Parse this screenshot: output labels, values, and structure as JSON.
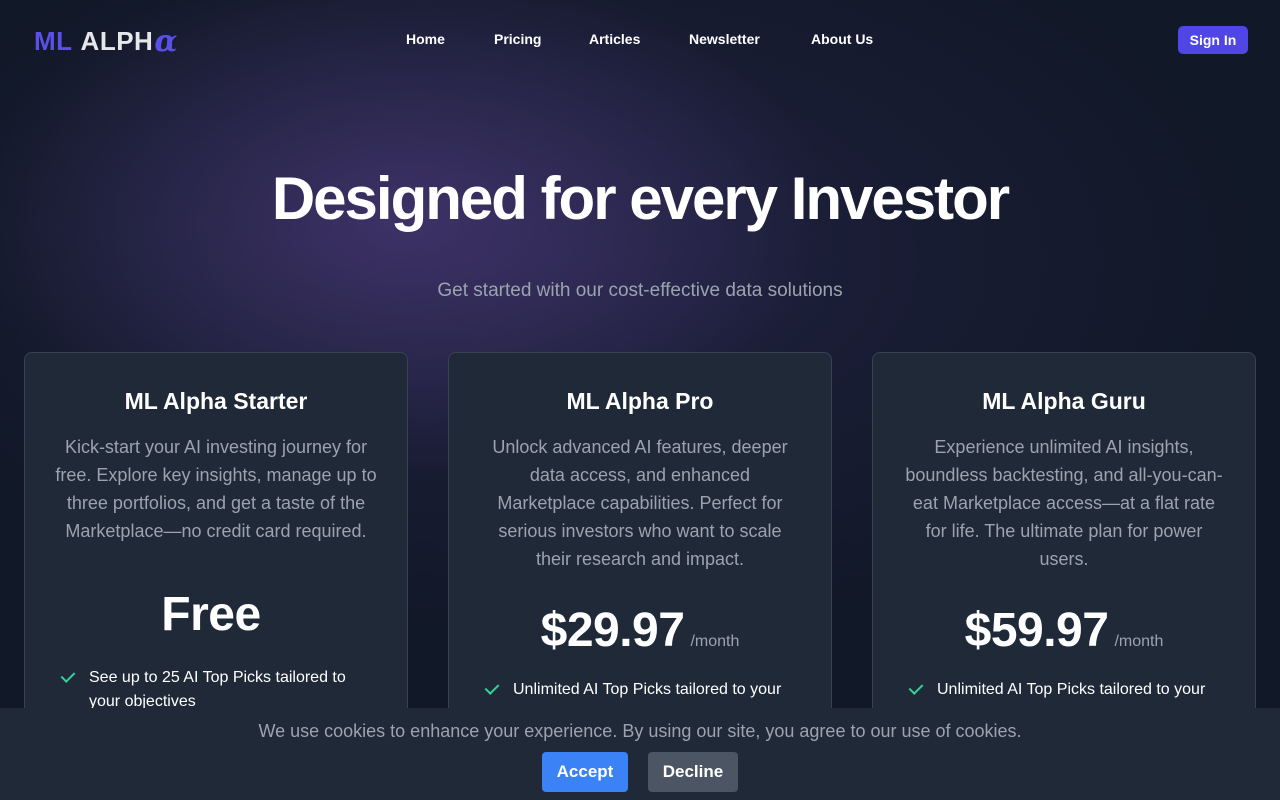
{
  "brand": {
    "logo_prefix": "ML",
    "logo_word": "ALPH",
    "logo_symbol": "α",
    "accent_color": "#5b50e6"
  },
  "nav": {
    "links": [
      "Home",
      "Pricing",
      "Articles",
      "Newsletter",
      "About Us"
    ],
    "signin_label": "Sign In"
  },
  "hero": {
    "title": "Designed for every Investor",
    "subtitle": "Get started with our cost-effective data solutions"
  },
  "plans": [
    {
      "name": "ML Alpha Starter",
      "description": "Kick-start your AI investing journey for free. Explore key insights, manage up to three portfolios, and get a taste of the Marketplace—no credit card required.",
      "price": "Free",
      "period": "",
      "feature": "See up to 25 AI Top Picks tailored to your objectives"
    },
    {
      "name": "ML Alpha Pro",
      "description": "Unlock advanced AI features, deeper data access, and enhanced Marketplace capabilities. Perfect for serious investors who want to scale their research and impact.",
      "price": "$29.97",
      "period": "/month",
      "feature": "Unlimited AI Top Picks tailored to your"
    },
    {
      "name": "ML Alpha Guru",
      "description": "Experience unlimited AI insights, boundless backtesting, and all-you-can-eat Marketplace access—at a flat rate for life. The ultimate plan for power users.",
      "price": "$59.97",
      "period": "/month",
      "feature": "Unlimited AI Top Picks tailored to your"
    }
  ],
  "cookie": {
    "message": "We use cookies to enhance your experience. By using our site, you agree to our use of cookies.",
    "accept_label": "Accept",
    "decline_label": "Decline"
  },
  "icons": {
    "feature_check": "checkmark-icon",
    "check_color": "#34d399"
  }
}
